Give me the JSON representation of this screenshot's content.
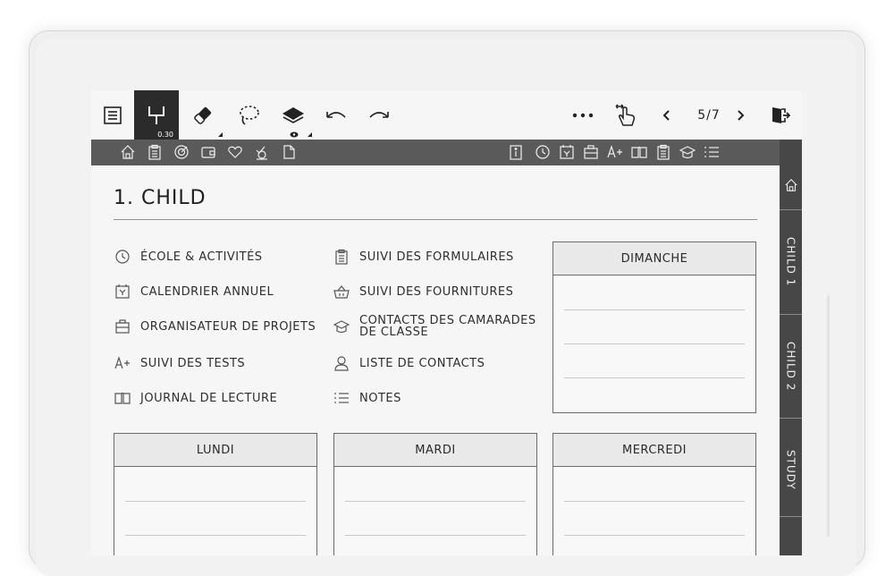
{
  "toolbar": {
    "pen_size": "0.30",
    "page_indicator": "5/7",
    "icons": [
      "list-icon",
      "pen-icon",
      "eraser-icon",
      "lasso-icon",
      "layers-icon",
      "undo-icon",
      "redo-icon",
      "more-icon",
      "swipe-gesture-icon",
      "prev-page-icon",
      "next-page-icon",
      "exit-icon"
    ]
  },
  "top_bar": {
    "left_icons": [
      "home-icon",
      "clipboard-icon",
      "target-icon",
      "wallet-icon",
      "heart-icon",
      "habit-icon",
      "document-icon"
    ],
    "right_icons": [
      "info-icon",
      "clock-icon",
      "calendar-icon",
      "briefcase-icon",
      "grade-icon",
      "book-icon",
      "clipboard-icon",
      "graduation-cap-icon",
      "list-icon"
    ]
  },
  "side_tabs": [
    "CHILD 1",
    "CHILD 2",
    "STUDY"
  ],
  "page": {
    "title": "1. CHILD"
  },
  "menu": {
    "col1": [
      {
        "label": "ÉCOLE & ACTIVITÉS",
        "icon": "clock-icon"
      },
      {
        "label": "CALENDRIER ANNUEL",
        "icon": "calendar-y-icon"
      },
      {
        "label": "ORGANISATEUR DE PROJETS",
        "icon": "briefcase-icon"
      },
      {
        "label": "SUIVI DES TESTS",
        "icon": "grade-a-plus-icon"
      },
      {
        "label": "JOURNAL DE LECTURE",
        "icon": "book-icon"
      }
    ],
    "col2": [
      {
        "label": "SUIVI DES FORMULAIRES",
        "icon": "clipboard-icon"
      },
      {
        "label": "SUIVI DES FOURNITURES",
        "icon": "basket-icon"
      },
      {
        "label": "CONTACTS DES CAMARADES DE CLASSE",
        "icon": "graduation-cap-icon"
      },
      {
        "label": "LISTE DE CONTACTS",
        "icon": "person-icon"
      },
      {
        "label": "NOTES",
        "icon": "list-icon"
      }
    ]
  },
  "days": {
    "sunday": "DIMANCHE",
    "monday": "LUNDI",
    "tuesday": "MARDI",
    "wednesday": "MERCREDI"
  },
  "colors": {
    "dark_bar": "#5a5a5a",
    "rail": "#474747",
    "screen": "#f6f6f6"
  }
}
